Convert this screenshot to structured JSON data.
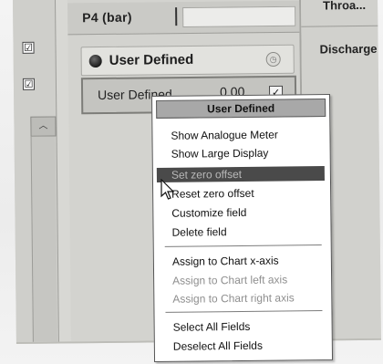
{
  "panel": {
    "p4_label": "P4 (bar)",
    "user_defined_header": "User Defined",
    "field_name": "User Defined",
    "field_value": "0.00",
    "field_checked": true
  },
  "left_column": {
    "checkbox_1": "☑",
    "checkbox_2": "☑"
  },
  "right_column": {
    "label_top": "Throa...",
    "label_discharge": "Discharge"
  },
  "context_menu": {
    "title": "User Defined",
    "items": [
      {
        "label": "Show Analogue Meter",
        "enabled": true
      },
      {
        "label": "Show Large Display",
        "enabled": true
      },
      {
        "label": "Set zero offset",
        "enabled": true,
        "highlighted": true
      },
      {
        "label": "Reset zero offset",
        "enabled": true
      },
      {
        "label": "Customize field",
        "enabled": true
      },
      {
        "label": "Delete field",
        "enabled": true
      },
      {
        "label": "Assign to Chart x-axis",
        "enabled": true
      },
      {
        "label": "Assign to Chart left axis",
        "enabled": false
      },
      {
        "label": "Assign to Chart right axis",
        "enabled": false
      },
      {
        "label": "Select All Fields",
        "enabled": true
      },
      {
        "label": "Deselect All Fields",
        "enabled": true
      }
    ]
  },
  "colors": {
    "menu_highlight": "#4a4a4a",
    "menu_title_bg": "#a8a8a8",
    "panel_bg": "#d3d3cf"
  },
  "icons": {
    "status_dot": "record-dot-icon",
    "clock": "clock-icon",
    "cursor": "mouse-pointer-icon"
  }
}
